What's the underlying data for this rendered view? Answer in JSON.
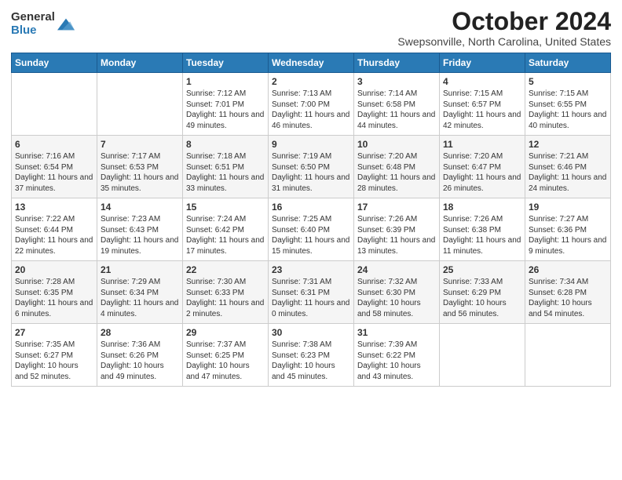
{
  "logo": {
    "general": "General",
    "blue": "Blue"
  },
  "title": "October 2024",
  "location": "Swepsonville, North Carolina, United States",
  "days_of_week": [
    "Sunday",
    "Monday",
    "Tuesday",
    "Wednesday",
    "Thursday",
    "Friday",
    "Saturday"
  ],
  "weeks": [
    [
      {
        "day": "",
        "info": ""
      },
      {
        "day": "",
        "info": ""
      },
      {
        "day": "1",
        "info": "Sunrise: 7:12 AM\nSunset: 7:01 PM\nDaylight: 11 hours and 49 minutes."
      },
      {
        "day": "2",
        "info": "Sunrise: 7:13 AM\nSunset: 7:00 PM\nDaylight: 11 hours and 46 minutes."
      },
      {
        "day": "3",
        "info": "Sunrise: 7:14 AM\nSunset: 6:58 PM\nDaylight: 11 hours and 44 minutes."
      },
      {
        "day": "4",
        "info": "Sunrise: 7:15 AM\nSunset: 6:57 PM\nDaylight: 11 hours and 42 minutes."
      },
      {
        "day": "5",
        "info": "Sunrise: 7:15 AM\nSunset: 6:55 PM\nDaylight: 11 hours and 40 minutes."
      }
    ],
    [
      {
        "day": "6",
        "info": "Sunrise: 7:16 AM\nSunset: 6:54 PM\nDaylight: 11 hours and 37 minutes."
      },
      {
        "day": "7",
        "info": "Sunrise: 7:17 AM\nSunset: 6:53 PM\nDaylight: 11 hours and 35 minutes."
      },
      {
        "day": "8",
        "info": "Sunrise: 7:18 AM\nSunset: 6:51 PM\nDaylight: 11 hours and 33 minutes."
      },
      {
        "day": "9",
        "info": "Sunrise: 7:19 AM\nSunset: 6:50 PM\nDaylight: 11 hours and 31 minutes."
      },
      {
        "day": "10",
        "info": "Sunrise: 7:20 AM\nSunset: 6:48 PM\nDaylight: 11 hours and 28 minutes."
      },
      {
        "day": "11",
        "info": "Sunrise: 7:20 AM\nSunset: 6:47 PM\nDaylight: 11 hours and 26 minutes."
      },
      {
        "day": "12",
        "info": "Sunrise: 7:21 AM\nSunset: 6:46 PM\nDaylight: 11 hours and 24 minutes."
      }
    ],
    [
      {
        "day": "13",
        "info": "Sunrise: 7:22 AM\nSunset: 6:44 PM\nDaylight: 11 hours and 22 minutes."
      },
      {
        "day": "14",
        "info": "Sunrise: 7:23 AM\nSunset: 6:43 PM\nDaylight: 11 hours and 19 minutes."
      },
      {
        "day": "15",
        "info": "Sunrise: 7:24 AM\nSunset: 6:42 PM\nDaylight: 11 hours and 17 minutes."
      },
      {
        "day": "16",
        "info": "Sunrise: 7:25 AM\nSunset: 6:40 PM\nDaylight: 11 hours and 15 minutes."
      },
      {
        "day": "17",
        "info": "Sunrise: 7:26 AM\nSunset: 6:39 PM\nDaylight: 11 hours and 13 minutes."
      },
      {
        "day": "18",
        "info": "Sunrise: 7:26 AM\nSunset: 6:38 PM\nDaylight: 11 hours and 11 minutes."
      },
      {
        "day": "19",
        "info": "Sunrise: 7:27 AM\nSunset: 6:36 PM\nDaylight: 11 hours and 9 minutes."
      }
    ],
    [
      {
        "day": "20",
        "info": "Sunrise: 7:28 AM\nSunset: 6:35 PM\nDaylight: 11 hours and 6 minutes."
      },
      {
        "day": "21",
        "info": "Sunrise: 7:29 AM\nSunset: 6:34 PM\nDaylight: 11 hours and 4 minutes."
      },
      {
        "day": "22",
        "info": "Sunrise: 7:30 AM\nSunset: 6:33 PM\nDaylight: 11 hours and 2 minutes."
      },
      {
        "day": "23",
        "info": "Sunrise: 7:31 AM\nSunset: 6:31 PM\nDaylight: 11 hours and 0 minutes."
      },
      {
        "day": "24",
        "info": "Sunrise: 7:32 AM\nSunset: 6:30 PM\nDaylight: 10 hours and 58 minutes."
      },
      {
        "day": "25",
        "info": "Sunrise: 7:33 AM\nSunset: 6:29 PM\nDaylight: 10 hours and 56 minutes."
      },
      {
        "day": "26",
        "info": "Sunrise: 7:34 AM\nSunset: 6:28 PM\nDaylight: 10 hours and 54 minutes."
      }
    ],
    [
      {
        "day": "27",
        "info": "Sunrise: 7:35 AM\nSunset: 6:27 PM\nDaylight: 10 hours and 52 minutes."
      },
      {
        "day": "28",
        "info": "Sunrise: 7:36 AM\nSunset: 6:26 PM\nDaylight: 10 hours and 49 minutes."
      },
      {
        "day": "29",
        "info": "Sunrise: 7:37 AM\nSunset: 6:25 PM\nDaylight: 10 hours and 47 minutes."
      },
      {
        "day": "30",
        "info": "Sunrise: 7:38 AM\nSunset: 6:23 PM\nDaylight: 10 hours and 45 minutes."
      },
      {
        "day": "31",
        "info": "Sunrise: 7:39 AM\nSunset: 6:22 PM\nDaylight: 10 hours and 43 minutes."
      },
      {
        "day": "",
        "info": ""
      },
      {
        "day": "",
        "info": ""
      }
    ]
  ]
}
